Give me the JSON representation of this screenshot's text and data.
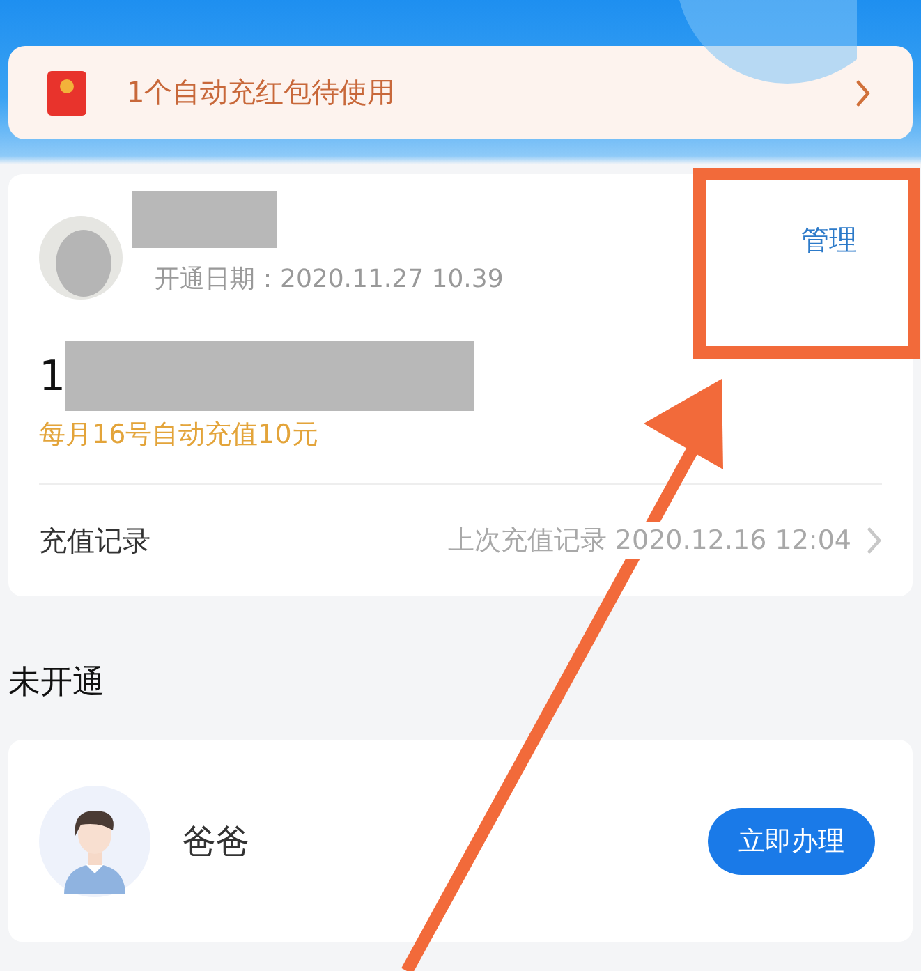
{
  "red_packet_banner": {
    "text": "1个自动充红包待使用"
  },
  "active_account": {
    "open_date": "开通日期：2020.11.27 10.39",
    "manage_link": "管理",
    "number_prefix": "1",
    "auto_recharge": "每月16号自动充值10元",
    "record_label": "充值记录",
    "last_record": "上次充值记录 2020.12.16 12:04"
  },
  "inactive_section": {
    "title": "未开通",
    "members": [
      {
        "name": "爸爸",
        "button": "立即办理"
      }
    ]
  }
}
